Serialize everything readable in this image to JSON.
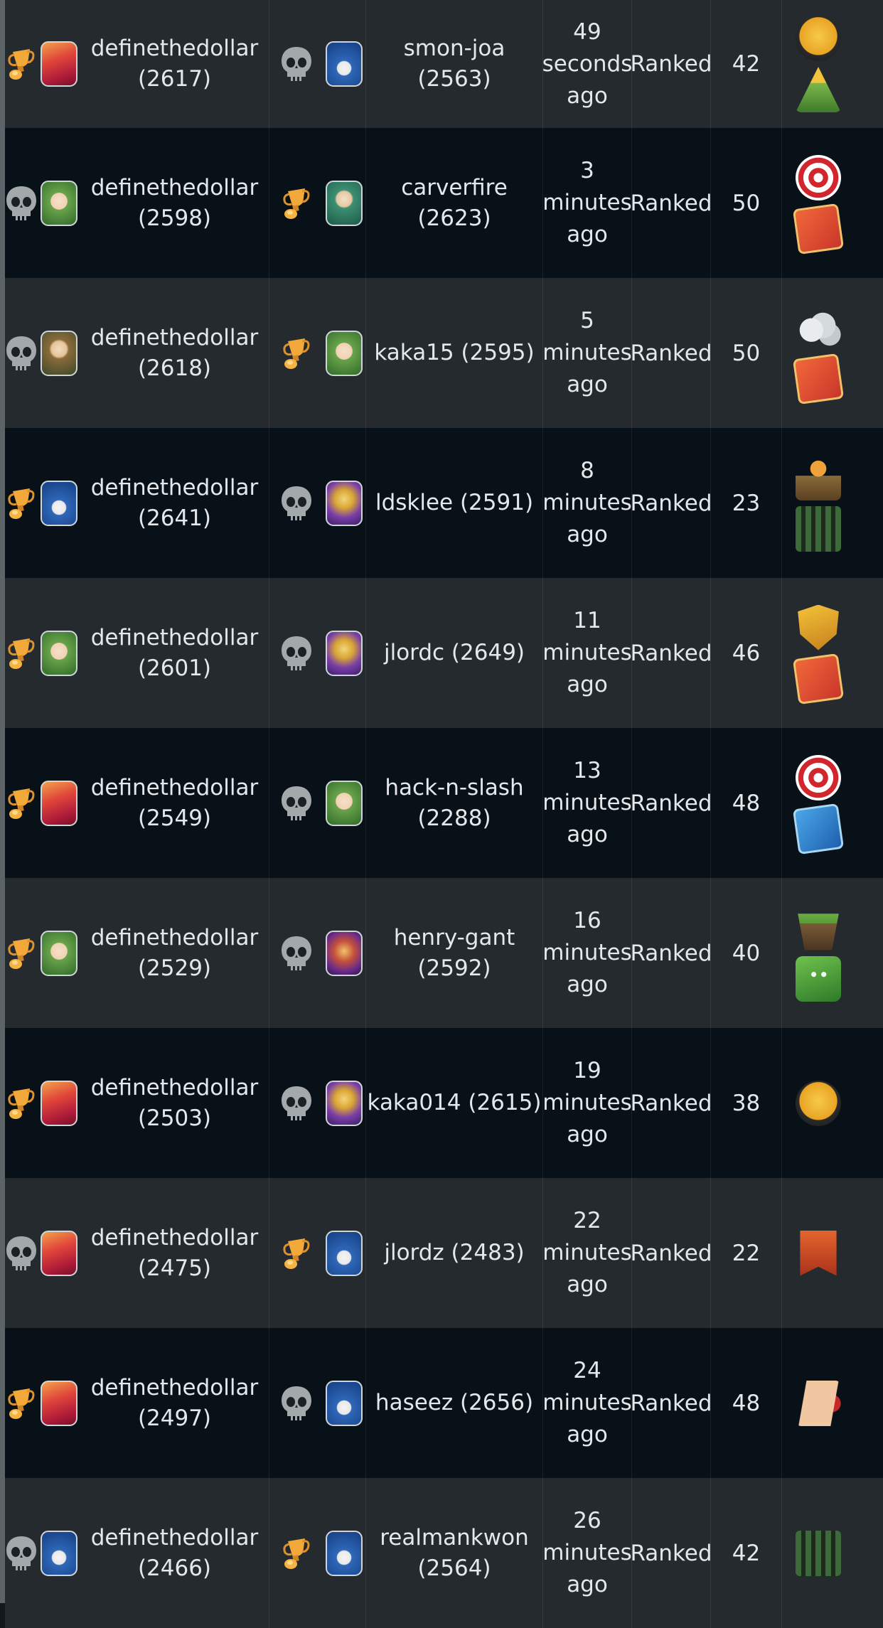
{
  "rows": [
    {
      "p1_result": "win",
      "p1_avatar": "red",
      "p1_name": "definethedollar",
      "p1_rating": "(2617)",
      "p2_result": "loss",
      "p2_avatar": "blue",
      "p2_name": "smon-joa (2563)",
      "p2_name2": "",
      "time_num": "49",
      "time_unit": "seconds",
      "time_ago": "ago",
      "match": "Ranked",
      "mana": "42",
      "rules": [
        "dark",
        "mtn"
      ]
    },
    {
      "p1_result": "loss",
      "p1_avatar": "green",
      "p1_name": "definethedollar",
      "p1_rating": "(2598)",
      "p2_result": "win",
      "p2_avatar": "teal",
      "p2_name": "carverfire (2623)",
      "p2_name2": "",
      "time_num": "3",
      "time_unit": "minutes",
      "time_ago": "ago",
      "match": "Ranked",
      "mana": "50",
      "rules": [
        "target",
        "cards"
      ]
    },
    {
      "p1_result": "loss",
      "p1_avatar": "brown",
      "p1_name": "definethedollar",
      "p1_rating": "(2618)",
      "p2_result": "win",
      "p2_avatar": "green",
      "p2_name": "kaka15 (2595)",
      "p2_name2": "",
      "time_num": "5",
      "time_unit": "minutes",
      "time_ago": "ago",
      "match": "Ranked",
      "mana": "50",
      "rules": [
        "cloud",
        "cards"
      ]
    },
    {
      "p1_result": "win",
      "p1_avatar": "blue",
      "p1_name": "definethedollar",
      "p1_rating": "(2641)",
      "p2_result": "loss",
      "p2_avatar": "gold",
      "p2_name": "ldsklee (2591)",
      "p2_name2": "",
      "time_num": "8",
      "time_unit": "minutes",
      "time_ago": "ago",
      "match": "Ranked",
      "mana": "23",
      "rules": [
        "training",
        "bars"
      ]
    },
    {
      "p1_result": "win",
      "p1_avatar": "green",
      "p1_name": "definethedollar",
      "p1_rating": "(2601)",
      "p2_result": "loss",
      "p2_avatar": "gold",
      "p2_name": "jlordc (2649)",
      "p2_name2": "",
      "time_num": "11",
      "time_unit": "minutes",
      "time_ago": "ago",
      "match": "Ranked",
      "mana": "46",
      "rules": [
        "shield",
        "cards"
      ]
    },
    {
      "p1_result": "win",
      "p1_avatar": "red",
      "p1_name": "definethedollar",
      "p1_rating": "(2549)",
      "p2_result": "loss",
      "p2_avatar": "green",
      "p2_name": "hack-n-slash",
      "p2_name2": "(2288)",
      "time_num": "13",
      "time_unit": "minutes",
      "time_ago": "ago",
      "match": "Ranked",
      "mana": "48",
      "rules": [
        "target",
        "cards-blue"
      ]
    },
    {
      "p1_result": "win",
      "p1_avatar": "green",
      "p1_name": "definethedollar",
      "p1_rating": "(2529)",
      "p2_result": "loss",
      "p2_avatar": "orange",
      "p2_name": "henry-gant",
      "p2_name2": "(2592)",
      "time_num": "16",
      "time_unit": "minutes",
      "time_ago": "ago",
      "match": "Ranked",
      "mana": "40",
      "rules": [
        "island",
        "goblin"
      ]
    },
    {
      "p1_result": "win",
      "p1_avatar": "red",
      "p1_name": "definethedollar",
      "p1_rating": "(2503)",
      "p2_result": "loss",
      "p2_avatar": "gold",
      "p2_name": "kaka014 (2615)",
      "p2_name2": "",
      "time_num": "19",
      "time_unit": "minutes",
      "time_ago": "ago",
      "match": "Ranked",
      "mana": "38",
      "rules": [
        "dark"
      ]
    },
    {
      "p1_result": "loss",
      "p1_avatar": "red",
      "p1_name": "definethedollar",
      "p1_rating": "(2475)",
      "p2_result": "win",
      "p2_avatar": "blue",
      "p2_name": "jlordz (2483)",
      "p2_name2": "",
      "time_num": "22",
      "time_unit": "minutes",
      "time_ago": "ago",
      "match": "Ranked",
      "mana": "22",
      "rules": [
        "banner"
      ]
    },
    {
      "p1_result": "win",
      "p1_avatar": "red",
      "p1_name": "definethedollar",
      "p1_rating": "(2497)",
      "p2_result": "loss",
      "p2_avatar": "blue",
      "p2_name": "haseez (2656)",
      "p2_name2": "",
      "time_num": "24",
      "time_unit": "minutes",
      "time_ago": "ago",
      "match": "Ranked",
      "mana": "48",
      "rules": [
        "band"
      ]
    },
    {
      "p1_result": "loss",
      "p1_avatar": "blue",
      "p1_name": "definethedollar",
      "p1_rating": "(2466)",
      "p2_result": "win",
      "p2_avatar": "blue",
      "p2_name": "realmankwon",
      "p2_name2": "(2564)",
      "time_num": "26",
      "time_unit": "minutes",
      "time_ago": "ago",
      "match": "Ranked",
      "mana": "42",
      "rules": [
        "bars"
      ]
    }
  ],
  "icons": {
    "win": "trophy-icon",
    "loss": "skull-icon"
  },
  "colors": {
    "row_odd": "#242a2e",
    "row_even": "#091118",
    "text": "#e4e8ea",
    "trophy": "#f0a43a",
    "skull": "#9aa0a4"
  }
}
